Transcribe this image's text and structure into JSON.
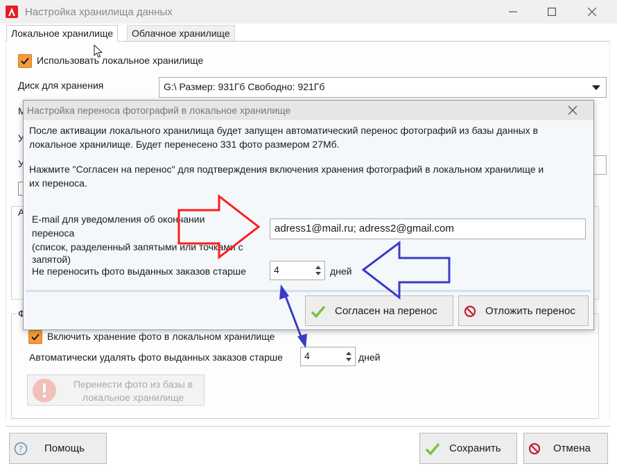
{
  "window": {
    "title": "Настройка хранилища данных"
  },
  "tabs": [
    {
      "label": "Локальное хранилище"
    },
    {
      "label": "Облачное хранилище"
    }
  ],
  "local": {
    "use_local_label": "Использовать локальное хранилище",
    "disk_label": "Диск для хранения",
    "disk_value": "G:\\ Размер: 931Гб Свободно: 921Гб",
    "cut_labels": [
      "М",
      "У",
      "У",
      "А",
      "Ф"
    ],
    "enable_photo_label": "Включить хранение фото в локальном хранилище",
    "auto_delete_label": "Автоматически удалять фото выданных заказов старше",
    "auto_delete_value": "4",
    "auto_delete_unit": "дней",
    "move_button_line1": "Перенести фото из базы в",
    "move_button_line2": "локальное хранилище"
  },
  "footer": {
    "help": "Помощь",
    "save": "Сохранить",
    "cancel": "Отмена"
  },
  "modal": {
    "title": "Настройка переноса фотографий в локальное хранилище",
    "para1_line1": "После активации локального хранилища будет запущен автоматический перенос фотографий из базы данных в",
    "para1_line2": "локальное хранилище. Будет перенесено 331 фото размером 27Мб.",
    "para2_line1": "Нажмите \"Согласен на перенос\" для подтверждения включения хранения фотографий в локальном хранилище и",
    "para2_line2": "их переноса.",
    "email_label_1": "E-mail для уведомления об окончании",
    "email_label_2": "переноса",
    "email_label_3": "(список, разделенный запятыми или точками с",
    "email_label_4": "запятой)",
    "email_value": "adress1@mail.ru; adress2@gmail.com",
    "keep_label": "Не переносить фото выданных заказов старше",
    "keep_value": "4",
    "keep_unit": "дней",
    "agree": "Согласен на перенос",
    "postpone": "Отложить перенос"
  },
  "colors": {
    "accent_orange": "#f39a3a",
    "check_green": "#7cc242",
    "stop_red": "#c0202a",
    "annotation_red": "#ff1a1a",
    "annotation_blue": "#3a3ac8"
  }
}
